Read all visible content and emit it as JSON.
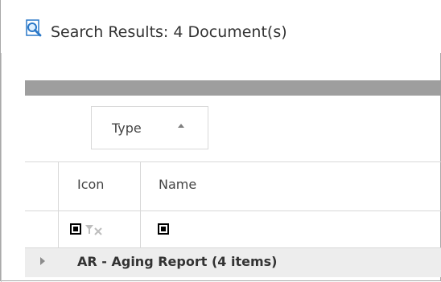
{
  "panel": {
    "title": "Search Results: 4 Document(s)",
    "icon": "search-document-icon"
  },
  "group_by": {
    "label": "Type",
    "sort": "ascending"
  },
  "grid": {
    "columns": [
      {
        "label": "Icon"
      },
      {
        "label": "Name"
      }
    ],
    "filter_row": {
      "icon_filter": "checkbox",
      "clear_filter_icon": "clear-filter-icon",
      "name_filter": "checkbox"
    },
    "groups": [
      {
        "label": "AR - Aging Report (4 items)",
        "expanded": false
      }
    ]
  },
  "colors": {
    "bar": "#9e9e9e",
    "group_row_bg": "#ededed",
    "search_icon": "#2a78c8"
  }
}
